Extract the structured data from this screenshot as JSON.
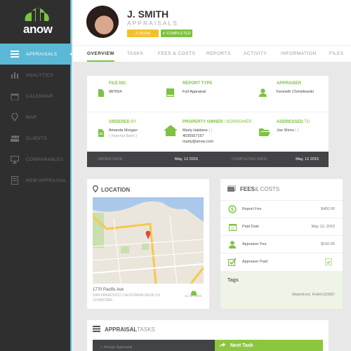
{
  "app": {
    "logo_text": "anow",
    "brand_color": "#7dc242",
    "accent_color": "#5bb8d6"
  },
  "sidebar": {
    "items": [
      {
        "label": "Appraisals",
        "icon": "list-icon",
        "active": true
      },
      {
        "label": "Analytics",
        "icon": "bar-chart-icon"
      },
      {
        "label": "Calendar",
        "icon": "calendar-icon"
      },
      {
        "label": "Map",
        "icon": "map-pin-icon"
      },
      {
        "label": "Clients",
        "icon": "users-icon"
      },
      {
        "label": "Comparables",
        "icon": "monitor-icon"
      },
      {
        "label": "New Appraisal",
        "icon": "form-icon"
      }
    ]
  },
  "header": {
    "name": "J. SMITH",
    "subtitle": "APPRAISALS",
    "badges": {
      "rush": "⚠ RUSH",
      "completed": "✔ COMPLETED"
    },
    "tabs": [
      "Overview",
      "Tasks",
      "Fees & Costs",
      "Reports",
      "Activity",
      "Information",
      "Files"
    ],
    "active_tab": "Overview"
  },
  "info": {
    "file_no": {
      "label": "File No.",
      "value": "987654"
    },
    "report_type": {
      "label": "Report Type",
      "value": "Full Appraisal"
    },
    "appraiser": {
      "label": "Appraiser",
      "value": "Kenneth Chmielewski"
    },
    "ordered_by": {
      "label_bold": "Ordered",
      "label_rest": " By",
      "name": "Amanda Morgan",
      "company": "( Imperial Bank )"
    },
    "property_owner": {
      "label_bold": "Property Owner",
      "label_rest": " / Borrower",
      "name": "Marty Haldane",
      "extra": " ( )",
      "phone": "4035557167",
      "email": "marty@anow.com"
    },
    "addressed_to": {
      "label_bold": "Addressed",
      "label_rest": " To",
      "name": "Joe Shmo",
      "extra": " ( )"
    },
    "order_date_label": "ORDER DATE :",
    "order_date": "May, 12 2015",
    "completed_date_label": "COMPLETED DATE :",
    "completed_date": "May, 12 2015"
  },
  "location": {
    "title": "LOCATION",
    "address": "1770 Pacific Ave",
    "city": "SAN FRANCISCO CALIFORNIA 94109 US",
    "phone": "1234567890",
    "distance": "11.82 miles"
  },
  "fees": {
    "title_bold": "FEES",
    "title_rest": " & COSTS",
    "rows": [
      {
        "label": "Report Fee",
        "value": "$400.00"
      },
      {
        "label": "Paid Date",
        "value": "May 13, 2015"
      },
      {
        "label": "Appraiser Fee",
        "value": "$150.00"
      },
      {
        "label": "Appraiser Paid",
        "value": ""
      }
    ],
    "appraiser_paid": true,
    "tags_label": "Tags",
    "tags_value": "Waterfront, FHA#120987"
  },
  "tasks": {
    "title_bold": "APPRAISAL",
    "title_rest": " TASKS",
    "current": "✓ Assign Appraisal",
    "next": "Next Task"
  }
}
